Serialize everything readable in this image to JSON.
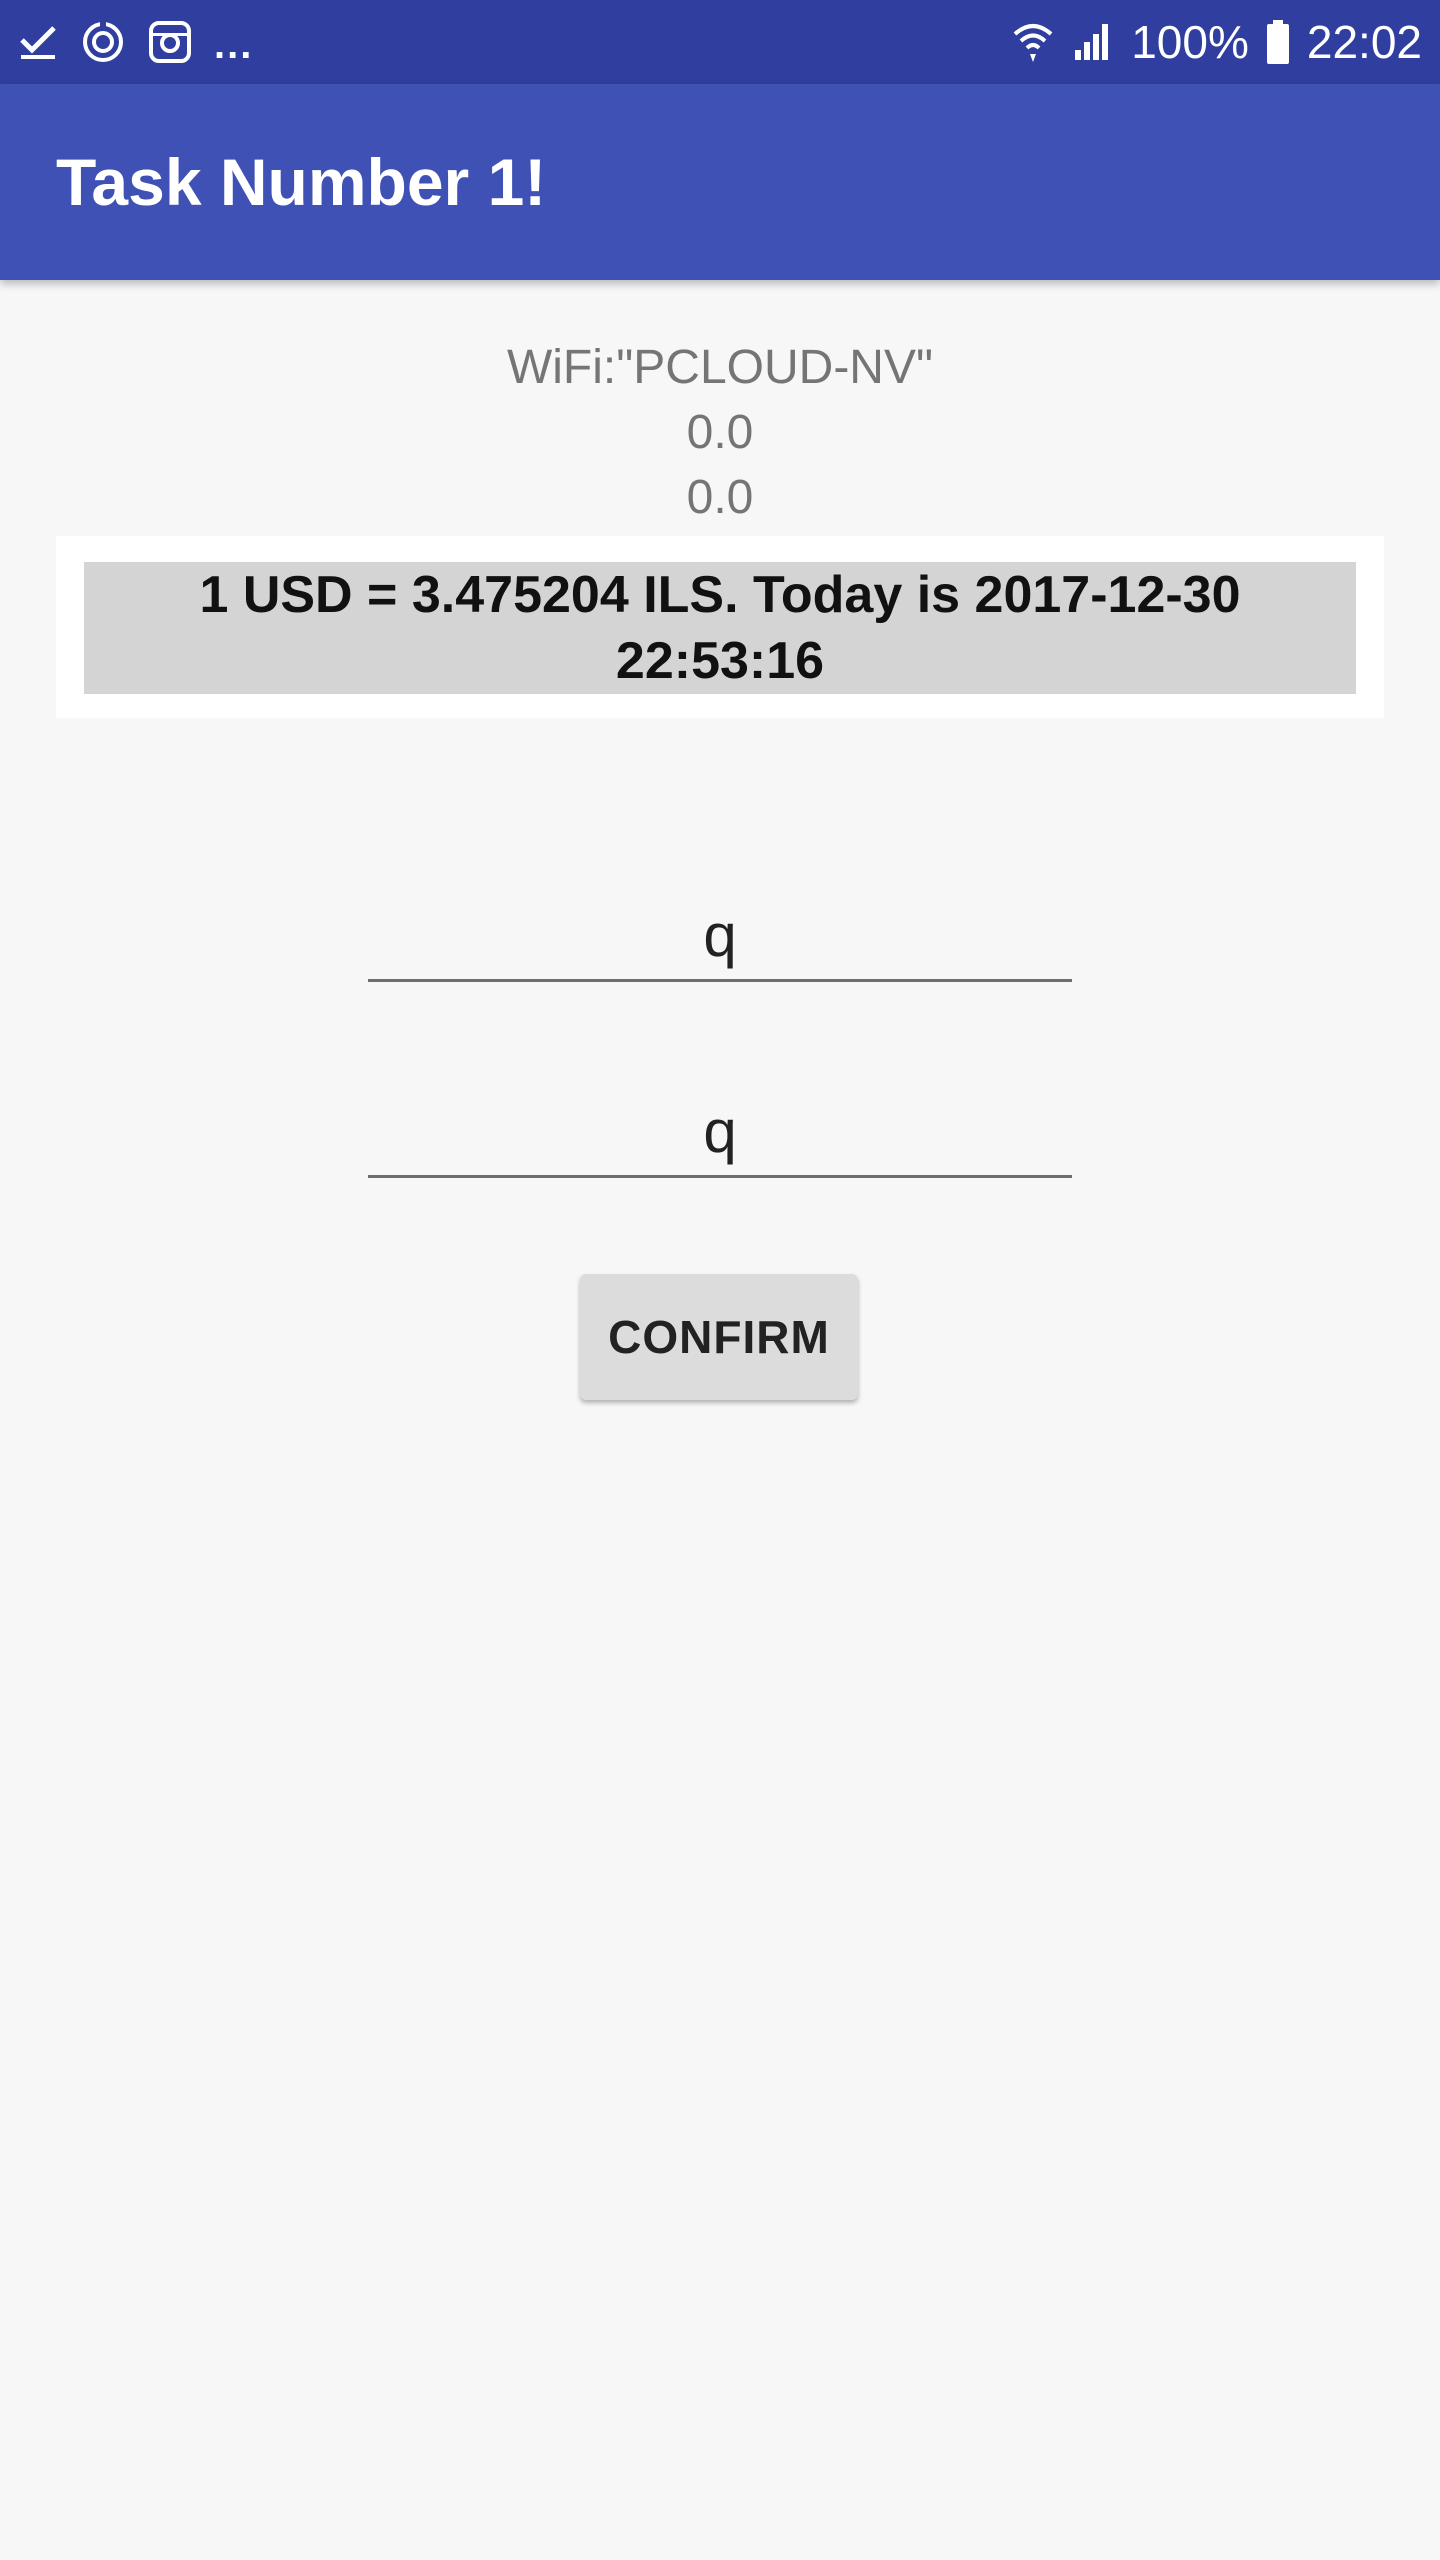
{
  "status_bar": {
    "icons_left": [
      "checkmark-icon",
      "sync-icon",
      "instagram-icon"
    ],
    "overflow": "...",
    "icons_right": [
      "wifi-icon",
      "signal-icon",
      "battery-icon"
    ],
    "battery_text": "100%",
    "time": "22:02",
    "color": "#303f9f"
  },
  "app_bar": {
    "title": "Task Number 1!",
    "color": "#3f51b5"
  },
  "info": {
    "wifi": "WiFi:\"PCLOUD-NV\"",
    "value_1": "0.0",
    "value_2": "0.0"
  },
  "rate": {
    "line_1": "1 USD = 3.475204 ILS. Today is 2017-12-30",
    "line_2": "22:53:16"
  },
  "form": {
    "field_1_value": "q",
    "field_2_value": "q",
    "confirm_label": "CONFIRM"
  }
}
